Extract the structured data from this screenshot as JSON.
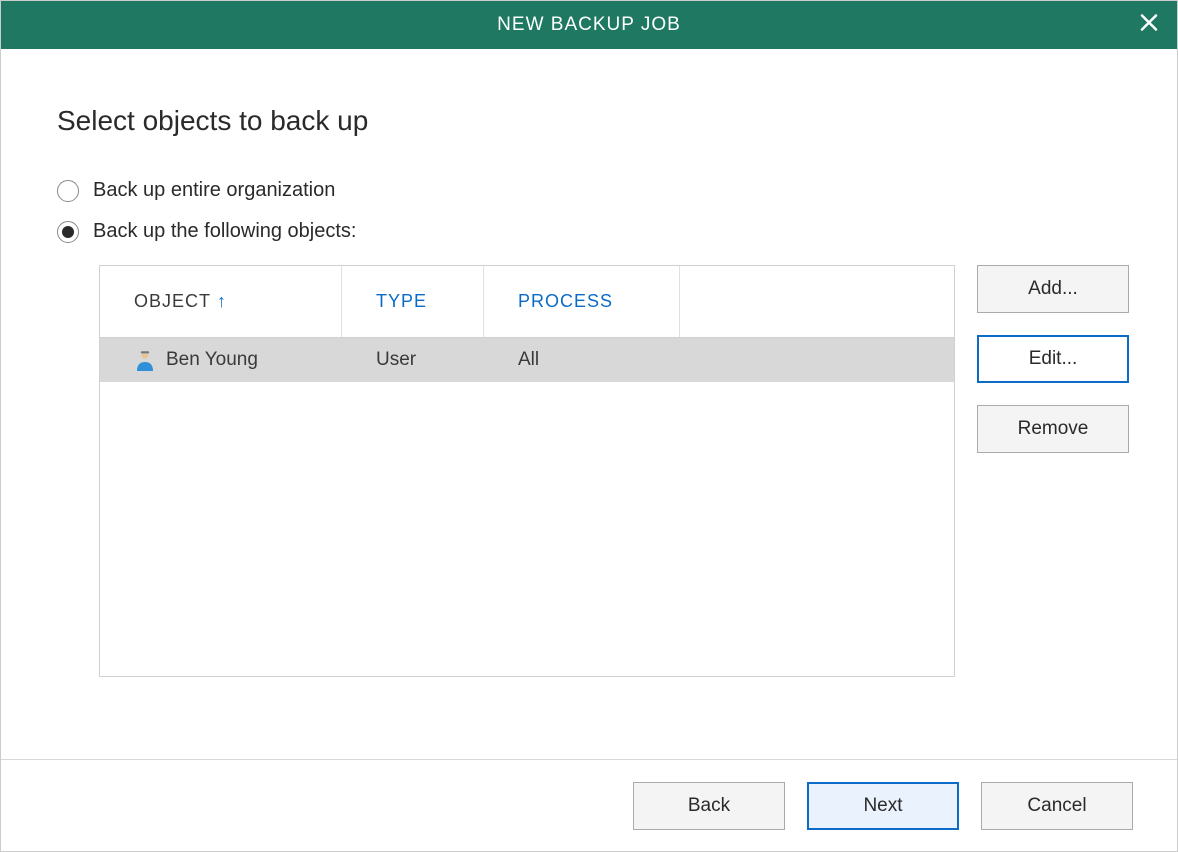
{
  "titlebar": {
    "title": "NEW BACKUP JOB"
  },
  "heading": "Select objects to back up",
  "options": {
    "entire": "Back up entire organization",
    "specific": "Back up the following objects:",
    "selected": "specific"
  },
  "table": {
    "headers": {
      "object": "OBJECT",
      "type": "TYPE",
      "process": "PROCESS"
    },
    "rows": [
      {
        "object": "Ben Young",
        "type": "User",
        "process": "All",
        "selected": true
      }
    ]
  },
  "sideButtons": {
    "add": "Add...",
    "edit": "Edit...",
    "remove": "Remove"
  },
  "footer": {
    "back": "Back",
    "next": "Next",
    "cancel": "Cancel"
  }
}
